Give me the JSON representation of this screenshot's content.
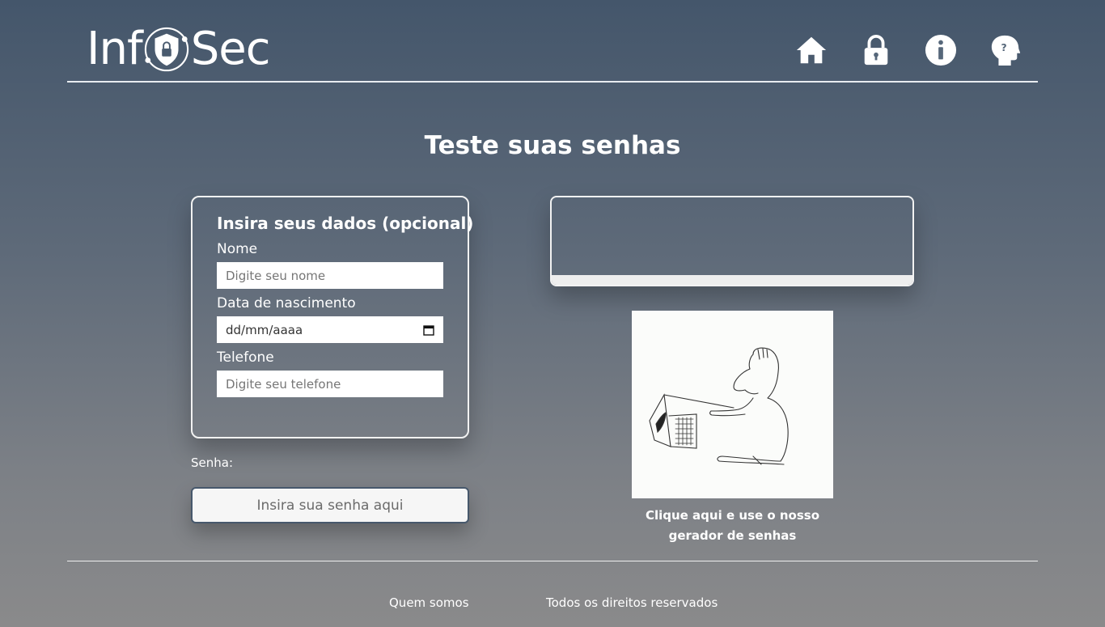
{
  "header": {
    "logo_left": "Inf",
    "logo_right": "Sec",
    "nav": [
      {
        "icon": "home-icon"
      },
      {
        "icon": "lock-icon"
      },
      {
        "icon": "info-icon"
      },
      {
        "icon": "head-question-icon"
      }
    ]
  },
  "page": {
    "title": "Teste suas senhas"
  },
  "form": {
    "heading": "Insira seus dados (opcional)",
    "name_label": "Nome",
    "name_placeholder": "Digite seu nome",
    "birth_label": "Data de nascimento",
    "birth_placeholder": "dd/mm/aaaa",
    "phone_label": "Telefone",
    "phone_placeholder": "Digite seu telefone"
  },
  "password": {
    "label": "Senha:",
    "placeholder": "Insira sua senha aqui"
  },
  "result": {
    "text": "",
    "strength": 0
  },
  "generator": {
    "caption_line1": "Clique aqui e use o nosso",
    "caption_line2": "gerador de senhas"
  },
  "footer": {
    "about": "Quem somos",
    "rights": "Todos os direitos reservados"
  },
  "colors": {
    "background_top": "#44566b",
    "background_bottom": "#8a8a8b",
    "text": "#ffffff",
    "input_border": "#47586c"
  }
}
